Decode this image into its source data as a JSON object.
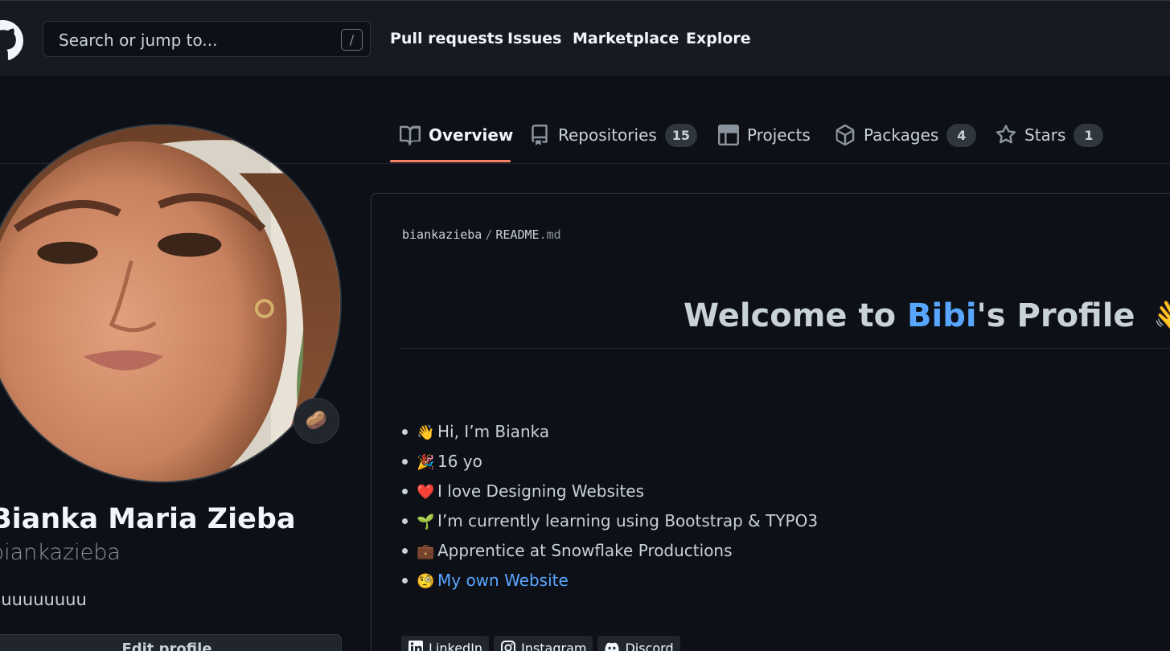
{
  "header": {
    "search_placeholder": "Search or jump to...",
    "search_shortcut": "/",
    "nav": [
      "Pull requests",
      "Issues",
      "Marketplace",
      "Explore"
    ]
  },
  "tabs": [
    {
      "label": "Overview",
      "icon": "book-icon",
      "active": true
    },
    {
      "label": "Repositories",
      "icon": "repo-icon",
      "count": "15"
    },
    {
      "label": "Projects",
      "icon": "table-icon"
    },
    {
      "label": "Packages",
      "icon": "package-icon",
      "count": "4"
    },
    {
      "label": "Stars",
      "icon": "star-icon",
      "count": "1"
    }
  ],
  "profile": {
    "status_emoji": "🥔",
    "full_name": "Bianka Maria Zieba",
    "username": "biankazieba",
    "bio": "huuuuuuuu",
    "edit_button": "Edit profile"
  },
  "readme": {
    "owner": "biankazieba",
    "separator": "/",
    "file_name": "README",
    "file_ext": ".md",
    "welcome_prefix": "Welcome to ",
    "welcome_name": "Bibi",
    "welcome_suffix": "'s Profile",
    "welcome_emoji": "👋",
    "items": [
      {
        "emoji": "👋",
        "text": "Hi, I’m Bianka"
      },
      {
        "emoji": "🎉",
        "text": "16 yo"
      },
      {
        "emoji": "❤️",
        "text": "I love Designing Websites"
      },
      {
        "emoji": "🌱",
        "text": "I’m currently learning using Bootstrap & TYPO3"
      },
      {
        "emoji": "💼",
        "text": "Apprentice at Snowflake Productions"
      },
      {
        "emoji": "🧐",
        "text": "My own Website"
      }
    ],
    "badges": [
      "LinkedIn",
      "Instagram",
      "Discord"
    ]
  },
  "colors": {
    "background": "#0d1117",
    "header": "#161b22",
    "accent_link": "#58a6ff",
    "tab_underline": "#f78166"
  }
}
